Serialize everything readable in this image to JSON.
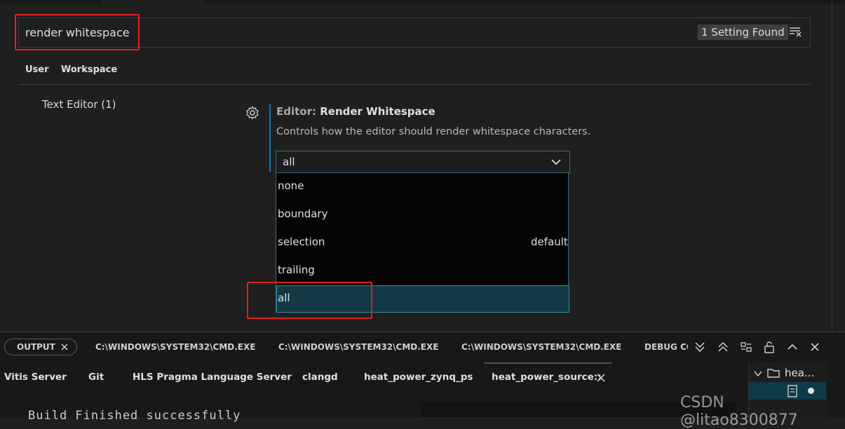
{
  "search": {
    "value": "render whitespace",
    "count": "1 Setting Found"
  },
  "scopes": {
    "user": "User",
    "workspace": "Workspace"
  },
  "toc": {
    "item": "Text Editor (1)"
  },
  "setting": {
    "category": "Editor:",
    "name": "Render Whitespace",
    "description": "Controls how the editor should render whitespace characters.",
    "current": "all",
    "options": [
      "none",
      "boundary",
      "selection",
      "trailing",
      "all"
    ],
    "default_label": "default"
  },
  "panel": {
    "tabs": [
      "OUTPUT",
      "C:\\WINDOWS\\SYSTEM32\\CMD.EXE",
      "C:\\WINDOWS\\SYSTEM32\\CMD.EXE",
      "C:\\WINDOWS\\SYSTEM32\\CMD.EXE",
      "DEBUG CC"
    ],
    "terminals": [
      "Vitis Server",
      "Git",
      "HLS Pragma Language Server",
      "clangd",
      "heat_power_zynq_ps",
      "heat_power_source::"
    ],
    "side_item": "hea...",
    "output_text": "Build Finished successfully"
  },
  "watermark": "CSDN @litao8300877",
  "colors": {
    "accent": "#0e7ab5",
    "highlight": "#e02020",
    "selected_option": "#133a44"
  }
}
